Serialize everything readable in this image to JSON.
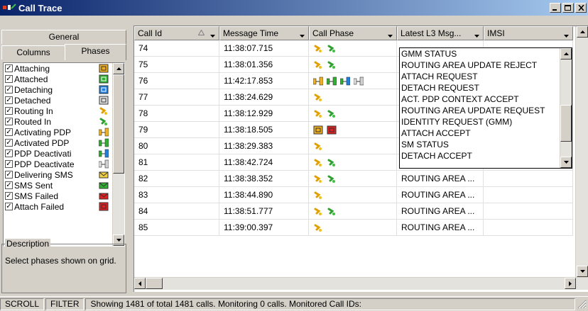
{
  "window": {
    "title": "Call Trace"
  },
  "colors": {
    "titlebar_start": "#0a246a",
    "titlebar_end": "#a6caf0",
    "face": "#d4d0c8"
  },
  "left_panel": {
    "tabs": [
      "General",
      "Columns",
      "Phases"
    ],
    "active_tab": "Phases",
    "phases": [
      {
        "label": "Attaching",
        "checked": true,
        "icon": "attaching-icon"
      },
      {
        "label": "Attached",
        "checked": true,
        "icon": "attached-icon"
      },
      {
        "label": "Detaching",
        "checked": true,
        "icon": "detaching-icon"
      },
      {
        "label": "Detached",
        "checked": true,
        "icon": "detached-icon"
      },
      {
        "label": "Routing In",
        "checked": true,
        "icon": "routing-in-icon"
      },
      {
        "label": "Routed In",
        "checked": true,
        "icon": "routed-in-icon"
      },
      {
        "label": "Activating PDP",
        "checked": true,
        "icon": "activating-pdp-icon"
      },
      {
        "label": "Activated PDP",
        "checked": true,
        "icon": "activated-pdp-icon"
      },
      {
        "label": "PDP Deactivati",
        "checked": true,
        "icon": "pdp-deactivating-icon"
      },
      {
        "label": "PDP Deactivate",
        "checked": true,
        "icon": "pdp-deactivated-icon"
      },
      {
        "label": "Delivering SMS",
        "checked": true,
        "icon": "delivering-sms-icon"
      },
      {
        "label": "SMS Sent",
        "checked": true,
        "icon": "sms-sent-icon"
      },
      {
        "label": "SMS Failed",
        "checked": true,
        "icon": "sms-failed-icon"
      },
      {
        "label": "Attach Failed",
        "checked": true,
        "icon": "attach-failed-icon"
      }
    ],
    "description": {
      "legend": "Description",
      "text": "Select phases shown on grid."
    }
  },
  "grid": {
    "columns": [
      "Call Id",
      "Message Time",
      "Call Phase",
      "Latest L3 Msg...",
      "IMSI"
    ],
    "rows": [
      {
        "call_id": "74",
        "time": "11:38:07.715",
        "phases": [
          "routing-in",
          "routed-in"
        ],
        "l3": ""
      },
      {
        "call_id": "75",
        "time": "11:38:01.356",
        "phases": [
          "routing-in",
          "routed-in"
        ],
        "l3": ""
      },
      {
        "call_id": "76",
        "time": "11:42:17.853",
        "phases": [
          "activating-pdp",
          "activated-pdp",
          "pdp-deactivating",
          "pdp-deactivated"
        ],
        "l3": ""
      },
      {
        "call_id": "77",
        "time": "11:38:24.629",
        "phases": [
          "routing-in"
        ],
        "l3": ""
      },
      {
        "call_id": "78",
        "time": "11:38:12.929",
        "phases": [
          "routing-in",
          "routed-in"
        ],
        "l3": ""
      },
      {
        "call_id": "79",
        "time": "11:38:18.505",
        "phases": [
          "attaching",
          "attach-failed"
        ],
        "l3": ""
      },
      {
        "call_id": "80",
        "time": "11:38:29.383",
        "phases": [
          "routing-in"
        ],
        "l3": "ROUTING AREA ..."
      },
      {
        "call_id": "81",
        "time": "11:38:42.724",
        "phases": [
          "routing-in",
          "routed-in"
        ],
        "l3": "ROUTING AREA ..."
      },
      {
        "call_id": "82",
        "time": "11:38:38.352",
        "phases": [
          "routing-in",
          "routed-in"
        ],
        "l3": "ROUTING AREA ..."
      },
      {
        "call_id": "83",
        "time": "11:38:44.890",
        "phases": [
          "routing-in"
        ],
        "l3": "ROUTING AREA ..."
      },
      {
        "call_id": "84",
        "time": "11:38:51.777",
        "phases": [
          "routing-in",
          "routed-in"
        ],
        "l3": "ROUTING AREA ..."
      },
      {
        "call_id": "85",
        "time": "11:39:00.397",
        "phases": [
          "routing-in"
        ],
        "l3": "ROUTING AREA ..."
      }
    ]
  },
  "l3_filter_dropdown": {
    "options": [
      "GMM STATUS",
      "ROUTING AREA UPDATE REJECT",
      "ATTACH REQUEST",
      "DETACH REQUEST",
      "ACT. PDP CONTEXT ACCEPT",
      "ROUTING AREA UPDATE REQUEST",
      "IDENTITY REQUEST (GMM)",
      "ATTACH ACCEPT",
      "SM STATUS",
      "DETACH ACCEPT"
    ]
  },
  "status_bar": {
    "scroll": "SCROLL",
    "filter": "FILTER",
    "message": "Showing 1481 of total 1481 calls. Monitoring 0 calls. Monitored Call IDs:"
  }
}
